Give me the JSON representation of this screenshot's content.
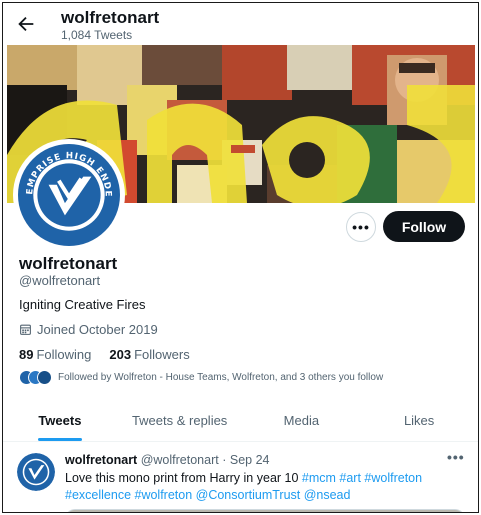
{
  "header": {
    "back_icon": "arrow-left-icon",
    "title": "wolfretonart",
    "tweet_count": "1,084 Tweets"
  },
  "profile": {
    "display_name": "wolfretonart",
    "handle": "@wolfretonart",
    "bio": "Igniting Creative Fires",
    "joined": "Joined October 2019",
    "following_count": "89",
    "following_label": "Following",
    "followers_count": "203",
    "followers_label": "Followers",
    "followed_by": "Followed by Wolfreton - House Teams, Wolfreton, and 3 others you follow",
    "more_label": "•••",
    "follow_label": "Follow",
    "avatar_text": "HAUTE EMPRISE HIGH ENDEAVOUR"
  },
  "tabs": [
    {
      "label": "Tweets",
      "active": true
    },
    {
      "label": "Tweets & replies",
      "active": false
    },
    {
      "label": "Media",
      "active": false
    },
    {
      "label": "Likes",
      "active": false
    }
  ],
  "tweet": {
    "author": "wolfretonart",
    "handle": "@wolfretonart",
    "separator": "·",
    "date": "Sep 24",
    "more_label": "•••",
    "text_plain": "Love this mono print from Harry in year 10 ",
    "hashtags_line1": "#mcm #art #wolfreton",
    "line2": "#excellence #wolfreton @ConsortiumTrust @nsead"
  },
  "colors": {
    "accent": "#1d9bf0",
    "text": "#0f1419",
    "muted": "#536471",
    "crest_blue": "#1f63a8"
  }
}
